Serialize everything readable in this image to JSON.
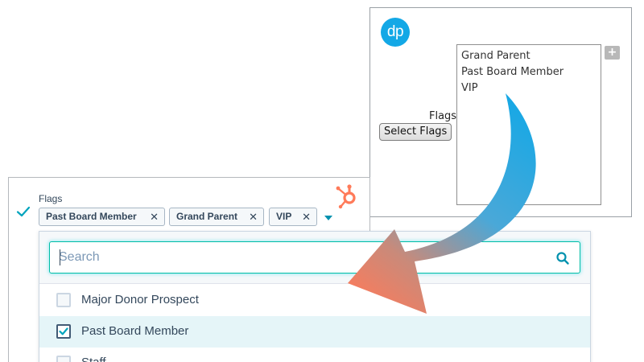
{
  "dp_panel": {
    "logo_text": "dp",
    "flags_label": "Flags",
    "select_button_label": "Select Flags",
    "list_items": [
      "Grand Parent",
      "Past Board Member",
      "VIP"
    ],
    "add_button_label": "+"
  },
  "hs_panel": {
    "flags_label": "Flags",
    "tags": [
      {
        "label": "Past Board Member",
        "remove": "✕"
      },
      {
        "label": "Grand Parent",
        "remove": "✕"
      },
      {
        "label": "VIP",
        "remove": "✕"
      }
    ],
    "search_placeholder": "Search",
    "options": [
      {
        "label": "Major Donor Prospect",
        "checked": false
      },
      {
        "label": "Past Board Member",
        "checked": true
      },
      {
        "label": "Staff",
        "checked": false
      }
    ]
  },
  "colors": {
    "dp_brand": "#13a8e6",
    "hubspot_orange": "#ff7a59",
    "arrow_start": "#13a8e6",
    "arrow_end": "#ff7a59",
    "accent_teal": "#00bda5",
    "selected_row": "#e5f5f8"
  },
  "icons": {
    "check": "check-icon",
    "hubspot_logo": "hubspot-sprocket-icon",
    "search": "search-icon",
    "caret": "caret-down-icon"
  }
}
